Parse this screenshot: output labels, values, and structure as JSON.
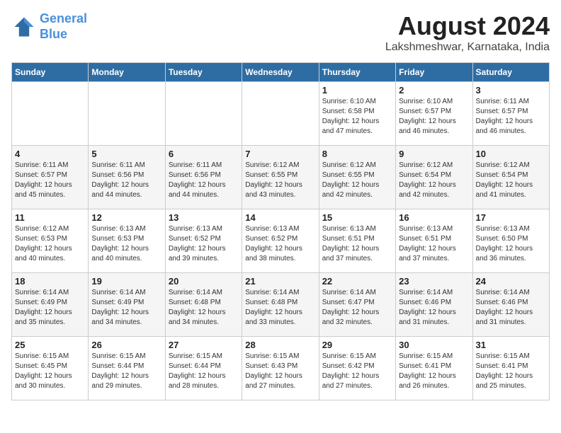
{
  "header": {
    "logo_line1": "General",
    "logo_line2": "Blue",
    "title": "August 2024",
    "subtitle": "Lakshmeshwar, Karnataka, India"
  },
  "weekdays": [
    "Sunday",
    "Monday",
    "Tuesday",
    "Wednesday",
    "Thursday",
    "Friday",
    "Saturday"
  ],
  "weeks": [
    [
      {
        "day": "",
        "info": ""
      },
      {
        "day": "",
        "info": ""
      },
      {
        "day": "",
        "info": ""
      },
      {
        "day": "",
        "info": ""
      },
      {
        "day": "1",
        "info": "Sunrise: 6:10 AM\nSunset: 6:58 PM\nDaylight: 12 hours\nand 47 minutes."
      },
      {
        "day": "2",
        "info": "Sunrise: 6:10 AM\nSunset: 6:57 PM\nDaylight: 12 hours\nand 46 minutes."
      },
      {
        "day": "3",
        "info": "Sunrise: 6:11 AM\nSunset: 6:57 PM\nDaylight: 12 hours\nand 46 minutes."
      }
    ],
    [
      {
        "day": "4",
        "info": "Sunrise: 6:11 AM\nSunset: 6:57 PM\nDaylight: 12 hours\nand 45 minutes."
      },
      {
        "day": "5",
        "info": "Sunrise: 6:11 AM\nSunset: 6:56 PM\nDaylight: 12 hours\nand 44 minutes."
      },
      {
        "day": "6",
        "info": "Sunrise: 6:11 AM\nSunset: 6:56 PM\nDaylight: 12 hours\nand 44 minutes."
      },
      {
        "day": "7",
        "info": "Sunrise: 6:12 AM\nSunset: 6:55 PM\nDaylight: 12 hours\nand 43 minutes."
      },
      {
        "day": "8",
        "info": "Sunrise: 6:12 AM\nSunset: 6:55 PM\nDaylight: 12 hours\nand 42 minutes."
      },
      {
        "day": "9",
        "info": "Sunrise: 6:12 AM\nSunset: 6:54 PM\nDaylight: 12 hours\nand 42 minutes."
      },
      {
        "day": "10",
        "info": "Sunrise: 6:12 AM\nSunset: 6:54 PM\nDaylight: 12 hours\nand 41 minutes."
      }
    ],
    [
      {
        "day": "11",
        "info": "Sunrise: 6:12 AM\nSunset: 6:53 PM\nDaylight: 12 hours\nand 40 minutes."
      },
      {
        "day": "12",
        "info": "Sunrise: 6:13 AM\nSunset: 6:53 PM\nDaylight: 12 hours\nand 40 minutes."
      },
      {
        "day": "13",
        "info": "Sunrise: 6:13 AM\nSunset: 6:52 PM\nDaylight: 12 hours\nand 39 minutes."
      },
      {
        "day": "14",
        "info": "Sunrise: 6:13 AM\nSunset: 6:52 PM\nDaylight: 12 hours\nand 38 minutes."
      },
      {
        "day": "15",
        "info": "Sunrise: 6:13 AM\nSunset: 6:51 PM\nDaylight: 12 hours\nand 37 minutes."
      },
      {
        "day": "16",
        "info": "Sunrise: 6:13 AM\nSunset: 6:51 PM\nDaylight: 12 hours\nand 37 minutes."
      },
      {
        "day": "17",
        "info": "Sunrise: 6:13 AM\nSunset: 6:50 PM\nDaylight: 12 hours\nand 36 minutes."
      }
    ],
    [
      {
        "day": "18",
        "info": "Sunrise: 6:14 AM\nSunset: 6:49 PM\nDaylight: 12 hours\nand 35 minutes."
      },
      {
        "day": "19",
        "info": "Sunrise: 6:14 AM\nSunset: 6:49 PM\nDaylight: 12 hours\nand 34 minutes."
      },
      {
        "day": "20",
        "info": "Sunrise: 6:14 AM\nSunset: 6:48 PM\nDaylight: 12 hours\nand 34 minutes."
      },
      {
        "day": "21",
        "info": "Sunrise: 6:14 AM\nSunset: 6:48 PM\nDaylight: 12 hours\nand 33 minutes."
      },
      {
        "day": "22",
        "info": "Sunrise: 6:14 AM\nSunset: 6:47 PM\nDaylight: 12 hours\nand 32 minutes."
      },
      {
        "day": "23",
        "info": "Sunrise: 6:14 AM\nSunset: 6:46 PM\nDaylight: 12 hours\nand 31 minutes."
      },
      {
        "day": "24",
        "info": "Sunrise: 6:14 AM\nSunset: 6:46 PM\nDaylight: 12 hours\nand 31 minutes."
      }
    ],
    [
      {
        "day": "25",
        "info": "Sunrise: 6:15 AM\nSunset: 6:45 PM\nDaylight: 12 hours\nand 30 minutes."
      },
      {
        "day": "26",
        "info": "Sunrise: 6:15 AM\nSunset: 6:44 PM\nDaylight: 12 hours\nand 29 minutes."
      },
      {
        "day": "27",
        "info": "Sunrise: 6:15 AM\nSunset: 6:44 PM\nDaylight: 12 hours\nand 28 minutes."
      },
      {
        "day": "28",
        "info": "Sunrise: 6:15 AM\nSunset: 6:43 PM\nDaylight: 12 hours\nand 27 minutes."
      },
      {
        "day": "29",
        "info": "Sunrise: 6:15 AM\nSunset: 6:42 PM\nDaylight: 12 hours\nand 27 minutes."
      },
      {
        "day": "30",
        "info": "Sunrise: 6:15 AM\nSunset: 6:41 PM\nDaylight: 12 hours\nand 26 minutes."
      },
      {
        "day": "31",
        "info": "Sunrise: 6:15 AM\nSunset: 6:41 PM\nDaylight: 12 hours\nand 25 minutes."
      }
    ]
  ]
}
